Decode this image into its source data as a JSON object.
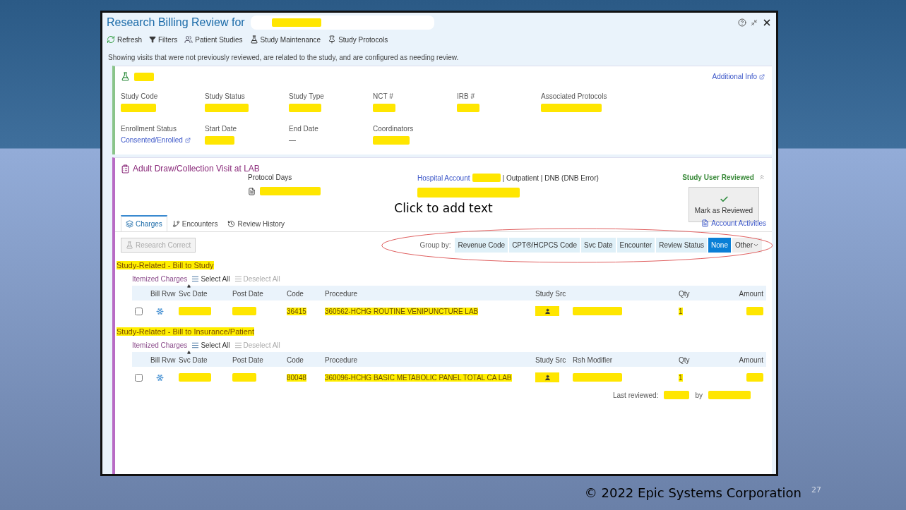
{
  "slide": {
    "placeholder_text": "Click to add text",
    "footer": "© 2022 Epic Systems Corporation",
    "page_number": "27"
  },
  "window": {
    "title": "Research Billing Review for"
  },
  "toolbar": [
    {
      "kind": "refresh",
      "label": "Refresh"
    },
    {
      "kind": "filter",
      "label": "Filters"
    },
    {
      "kind": "people",
      "label": "Patient Studies"
    },
    {
      "kind": "flask",
      "label": "Study Maintenance"
    },
    {
      "kind": "protocol",
      "label": "Study Protocols"
    }
  ],
  "notice": "Showing visits that were not previously reviewed, are related to the study, and are configured as needing review.",
  "study": {
    "link": "Additional Info",
    "fields": [
      {
        "label": "Study Code",
        "kind": "redacted"
      },
      {
        "label": "Study Status",
        "kind": "redacted"
      },
      {
        "label": "Study Type",
        "kind": "redacted"
      },
      {
        "label": "NCT #",
        "kind": "redacted"
      },
      {
        "label": "IRB #",
        "kind": "redacted"
      },
      {
        "label": "Associated Protocols",
        "kind": "redacted"
      },
      {
        "label": "Enrollment Status",
        "kind": "link",
        "value": "Consented/Enrolled"
      },
      {
        "label": "Start Date",
        "kind": "redacted"
      },
      {
        "label": "End Date",
        "kind": "text",
        "value": "—"
      },
      {
        "label": "Coordinators",
        "kind": "redacted"
      }
    ]
  },
  "visit": {
    "title": "Adult Draw/Collection Visit at LAB",
    "protocol_days": "Protocol Days",
    "hospital_account": "Hospital Account",
    "account_info": "| Outpatient | DNB (DNB Error)",
    "review_status": "Study User Reviewed",
    "mark_button": "Mark as Reviewed",
    "account_activities": "Account Activities"
  },
  "tabs": [
    {
      "kind": "charges",
      "label": "Charges",
      "selected": true
    },
    {
      "kind": "encounters",
      "label": "Encounters",
      "selected": false
    },
    {
      "kind": "history",
      "label": "Review History",
      "selected": false
    }
  ],
  "research_correct": {
    "label": "Research Correct",
    "disabled": true
  },
  "group_by": {
    "label": "Group by:",
    "options": [
      {
        "label": "Revenue Code",
        "selected": false
      },
      {
        "label": "CPT®/HCPCS Code",
        "selected": false
      },
      {
        "label": "Svc Date",
        "selected": false
      },
      {
        "label": "Encounter",
        "selected": false
      },
      {
        "label": "Review Status",
        "selected": false
      },
      {
        "label": "None",
        "selected": true
      }
    ],
    "other": "Other"
  },
  "sections": [
    {
      "title": "Study-Related - Bill to Study",
      "highlighted": true,
      "itemized": "Itemized Charges",
      "select_all": "Select All",
      "deselect_all": "Deselect All",
      "columns": [
        "Bill Rvw",
        "Svc Date",
        "Post Date",
        "Code",
        "Procedure",
        "Study Src",
        "",
        "Qty",
        "Amount"
      ],
      "rows": [
        {
          "checked": false,
          "code": "36415",
          "procedure": "360562-HCHG ROUTINE VENIPUNCTURE LAB",
          "qty": "1"
        }
      ]
    },
    {
      "title": "Study-Related - Bill to Insurance/Patient",
      "highlighted": true,
      "itemized": "Itemized Charges",
      "select_all": "Select All",
      "deselect_all": "Deselect All",
      "columns": [
        "Bill Rvw",
        "Svc Date",
        "Post Date",
        "Code",
        "Procedure",
        "Study Src",
        "Rsh Modifier",
        "Qty",
        "Amount"
      ],
      "rows": [
        {
          "checked": false,
          "code": "80048",
          "procedure": "360096-HCHG BASIC METABOLIC PANEL TOTAL CA LAB",
          "qty": "1"
        }
      ]
    }
  ],
  "last_reviewed": {
    "label": "Last reviewed:",
    "by": "by"
  }
}
